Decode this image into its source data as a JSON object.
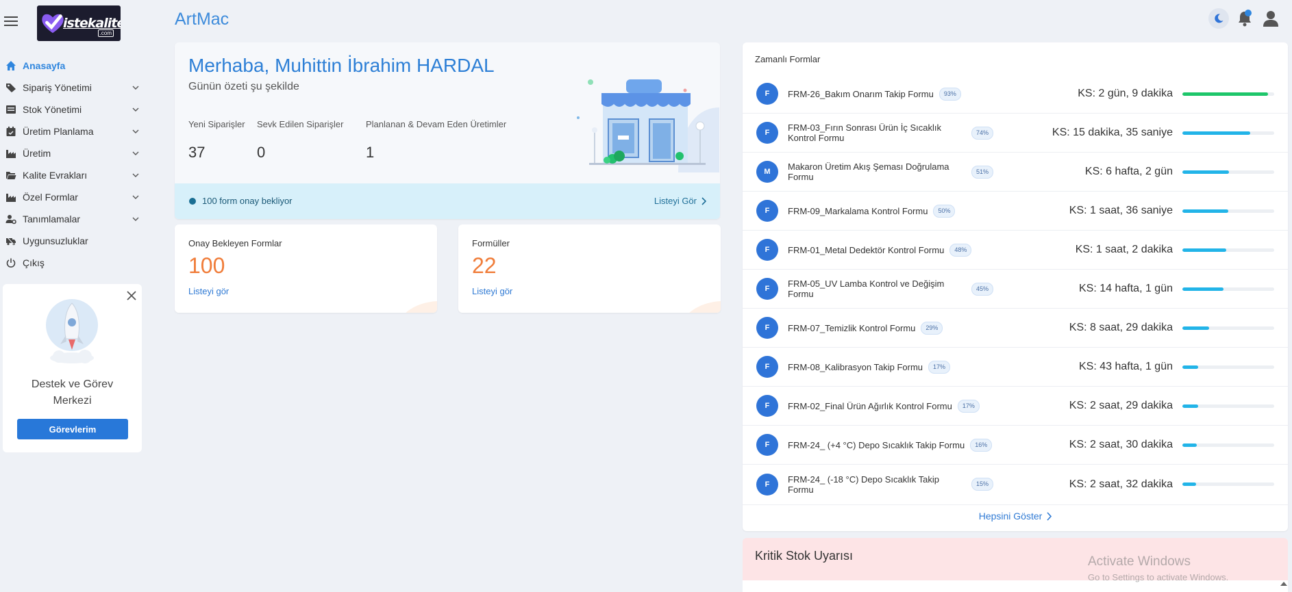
{
  "header": {
    "logo_text": "istekalite",
    "logo_sub": ".com",
    "app_title": "ArtMac",
    "icons": [
      "moon-icon",
      "bell-icon",
      "user-icon"
    ]
  },
  "sidebar": {
    "items": [
      {
        "label": "Anasayfa",
        "icon": "home-icon",
        "expandable": false,
        "active": true
      },
      {
        "label": "Sipariş Yönetimi",
        "icon": "tag-icon",
        "expandable": true
      },
      {
        "label": "Stok Yönetimi",
        "icon": "stack-icon",
        "expandable": true
      },
      {
        "label": "Üretim Planlama",
        "icon": "calendar-icon",
        "expandable": true
      },
      {
        "label": "Üretim",
        "icon": "factory-icon",
        "expandable": true
      },
      {
        "label": "Kalite Evrakları",
        "icon": "folder-icon",
        "expandable": true
      },
      {
        "label": "Özel Formlar",
        "icon": "factory-icon",
        "expandable": true
      },
      {
        "label": "Tanımlamalar",
        "icon": "user-gear-icon",
        "expandable": true
      },
      {
        "label": "Uygunsuzluklar",
        "icon": "truck-icon",
        "expandable": false
      },
      {
        "label": "Çıkış",
        "icon": "power-icon",
        "expandable": false
      }
    ],
    "support": {
      "title": "Destek ve Görev Merkezi",
      "button": "Görevlerim"
    }
  },
  "welcome": {
    "greeting": "Merhaba, Muhittin İbrahim HARDAL",
    "subtitle": "Günün özeti şu şekilde",
    "stats": [
      {
        "label": "Yeni Siparişler",
        "value": "37"
      },
      {
        "label": "Sevk Edilen Siparişler",
        "value": "0"
      },
      {
        "label": "Planlanan & Devam Eden Üretimler",
        "value": "1"
      }
    ],
    "approval_text": "100 form onay bekliyor",
    "approval_link": "Listeyi Gör"
  },
  "cards": [
    {
      "title": "Onay Bekleyen Formlar",
      "value": "100",
      "link": "Listeyi gör"
    },
    {
      "title": "Formüller",
      "value": "22",
      "link": "Listeyi gör"
    }
  ],
  "timed_forms": {
    "title": "Zamanlı Formlar",
    "items": [
      {
        "avatar": "F",
        "name": "FRM-26_Bakım Onarım Takip Formu",
        "pct": "93%",
        "progress": 0.93,
        "ks": "KS: 2 gün, 9 dakika",
        "color": "#1ec66a"
      },
      {
        "avatar": "F",
        "name": "FRM-03_Fırın Sonrası Ürün İç Sıcaklık Kontrol Formu",
        "pct": "74%",
        "progress": 0.74,
        "ks": "KS: 15 dakika, 35 saniye",
        "color": "#22b4e8"
      },
      {
        "avatar": "M",
        "name": "Makaron Üretim Akış Şeması Doğrulama Formu",
        "pct": "51%",
        "progress": 0.51,
        "ks": "KS: 6 hafta, 2 gün",
        "color": "#22b4e8"
      },
      {
        "avatar": "F",
        "name": "FRM-09_Markalama Kontrol Formu",
        "pct": "50%",
        "progress": 0.5,
        "ks": "KS: 1 saat, 36 saniye",
        "color": "#22b4e8"
      },
      {
        "avatar": "F",
        "name": "FRM-01_Metal Dedektör Kontrol Formu",
        "pct": "48%",
        "progress": 0.48,
        "ks": "KS: 1 saat, 2 dakika",
        "color": "#22b4e8"
      },
      {
        "avatar": "F",
        "name": "FRM-05_UV Lamba Kontrol ve Değişim Formu",
        "pct": "45%",
        "progress": 0.45,
        "ks": "KS: 14 hafta, 1 gün",
        "color": "#22b4e8"
      },
      {
        "avatar": "F",
        "name": "FRM-07_Temizlik Kontrol Formu",
        "pct": "29%",
        "progress": 0.29,
        "ks": "KS: 8 saat, 29 dakika",
        "color": "#22b4e8"
      },
      {
        "avatar": "F",
        "name": "FRM-08_Kalibrasyon Takip Formu",
        "pct": "17%",
        "progress": 0.17,
        "ks": "KS: 43 hafta, 1 gün",
        "color": "#22b4e8"
      },
      {
        "avatar": "F",
        "name": "FRM-02_Final Ürün Ağırlık Kontrol Formu",
        "pct": "17%",
        "progress": 0.17,
        "ks": "KS: 2 saat, 29 dakika",
        "color": "#22b4e8"
      },
      {
        "avatar": "F",
        "name": "FRM-24_ (+4 °C) Depo Sıcaklık Takip Formu",
        "pct": "16%",
        "progress": 0.16,
        "ks": "KS: 2 saat, 30 dakika",
        "color": "#22b4e8"
      },
      {
        "avatar": "F",
        "name": "FRM-24_ (-18 °C) Depo Sıcaklık Takip Formu",
        "pct": "15%",
        "progress": 0.15,
        "ks": "KS: 2 saat, 32 dakika",
        "color": "#22b4e8"
      }
    ],
    "show_all": "Hepsini Göster"
  },
  "critical_stock": {
    "title": "Kritik Stok Uyarısı"
  },
  "watermark": {
    "line1": "Activate Windows",
    "line2": "Go to Settings to activate Windows."
  }
}
